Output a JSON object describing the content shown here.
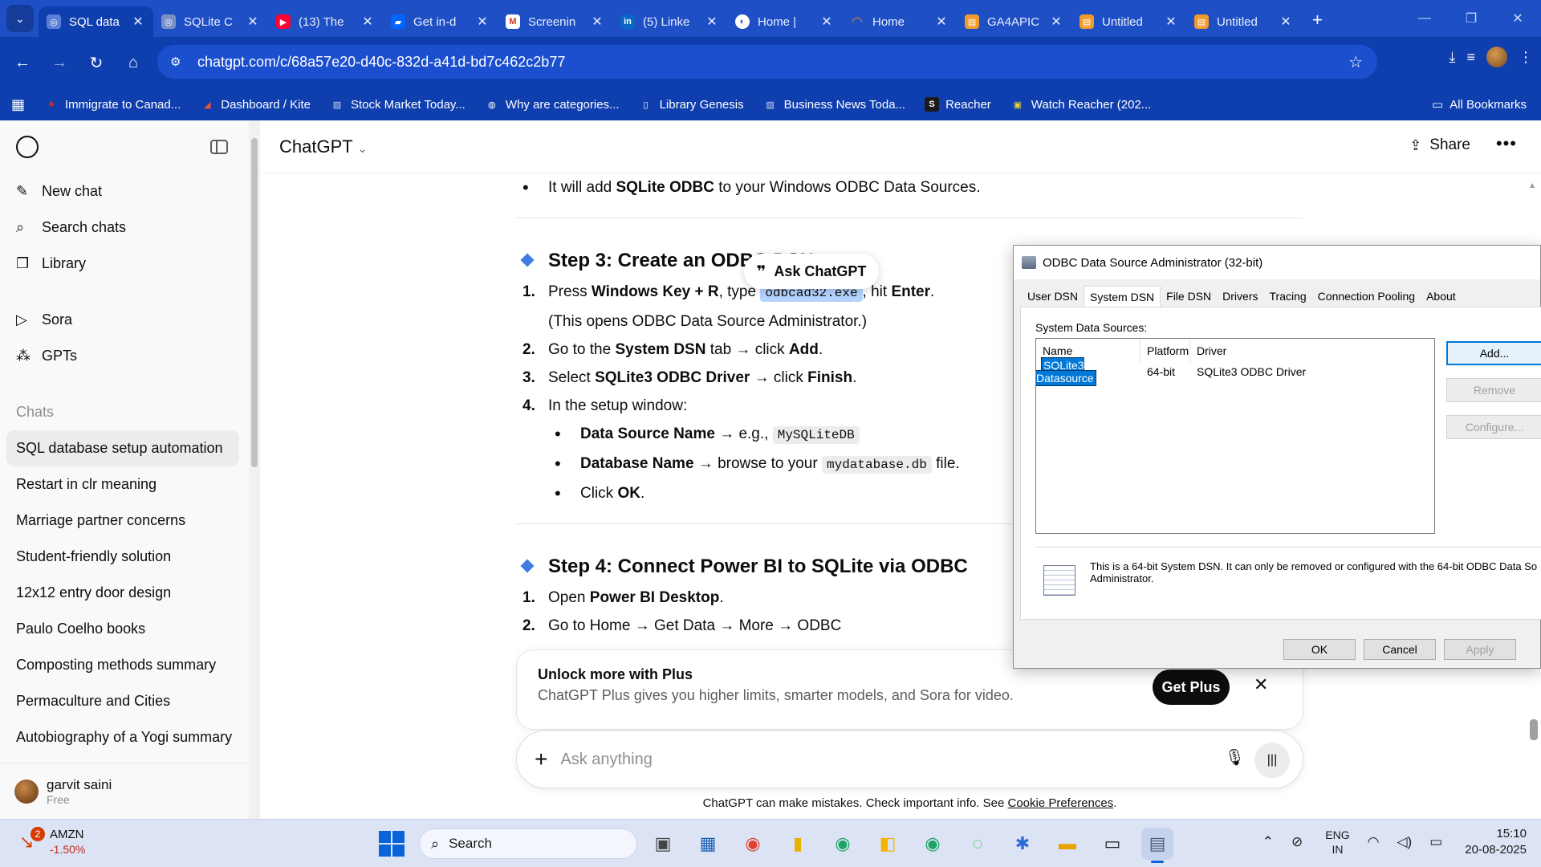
{
  "browser": {
    "tabs": [
      {
        "title": "SQL data",
        "icon": "chatgpt-icon",
        "active": true
      },
      {
        "title": "SQLite C",
        "icon": "chatgpt-icon"
      },
      {
        "title": "(13) The",
        "icon": "youtube-icon"
      },
      {
        "title": "Get in-d",
        "icon": "power-automate-icon"
      },
      {
        "title": "Screenin",
        "icon": "gmail-icon"
      },
      {
        "title": "(5) Linke",
        "icon": "linkedin-icon"
      },
      {
        "title": "Home | ",
        "icon": "bookmark-app-icon"
      },
      {
        "title": "Home",
        "icon": "loading-spinner-icon"
      },
      {
        "title": "GA4APIC",
        "icon": "orange-doc-icon"
      },
      {
        "title": "Untitled",
        "icon": "orange-doc-icon"
      },
      {
        "title": "Untitled",
        "icon": "orange-doc-icon"
      }
    ],
    "url": "chatgpt.com/c/68a57e20-d40c-832d-a41d-bd7c462c2b77",
    "bookmarks": [
      {
        "label": "Immigrate to Canad...",
        "icon": "maple-leaf-icon",
        "color": "#d52b1e"
      },
      {
        "label": "Dashboard / Kite",
        "icon": "kite-icon",
        "color": "#f0512f"
      },
      {
        "label": "Stock Market Today...",
        "icon": "news-icon",
        "color": "#cfd8ee"
      },
      {
        "label": "Why are categories...",
        "icon": "globe-icon",
        "color": "#ffffff"
      },
      {
        "label": "Library Genesis",
        "icon": "book-icon",
        "color": "#ffffff"
      },
      {
        "label": "Business News Toda...",
        "icon": "news-icon",
        "color": "#cfd8ee"
      },
      {
        "label": "Reacher",
        "icon": "s-icon",
        "color": "#1a1a1a"
      },
      {
        "label": "Watch Reacher (202...",
        "icon": "tv-icon",
        "color": "#e8d13a"
      }
    ],
    "all_bookmarks": "All Bookmarks"
  },
  "sidebar": {
    "nav": [
      {
        "label": "New chat",
        "icon": "new-chat-icon"
      },
      {
        "label": "Search chats",
        "icon": "search-icon"
      },
      {
        "label": "Library",
        "icon": "library-icon"
      }
    ],
    "nav2": [
      {
        "label": "Sora",
        "icon": "sora-icon"
      },
      {
        "label": "GPTs",
        "icon": "gpts-icon"
      }
    ],
    "chats_label": "Chats",
    "chats": [
      "SQL database setup automation",
      "Restart in clr meaning",
      "Marriage partner concerns",
      "Student-friendly solution",
      "12x12 entry door design",
      "Paulo Coelho books",
      "Composting methods summary",
      "Permaculture and Cities",
      "Autobiography of a Yogi summary"
    ],
    "user": {
      "name": "garvit saini",
      "plan": "Free"
    }
  },
  "header": {
    "model": "ChatGPT",
    "share": "Share"
  },
  "content": {
    "bullet_top": {
      "pre": "It will add ",
      "bold": "SQLite ODBC",
      "post": " to your Windows ODBC Data Sources."
    },
    "step3_title": "Step 3: Create an ODBC DSN",
    "ask_chatgpt": "Ask ChatGPT",
    "s3_1": {
      "a": "Press ",
      "b": "Windows Key + R",
      "c": ", type ",
      "code": "odbcad32.exe",
      "d": ", hit ",
      "e": "Enter",
      "f": "."
    },
    "s3_1b": "(This opens ODBC Data Source Administrator.)",
    "s3_2": {
      "a": "Go to the ",
      "b": "System DSN",
      "c": " tab → click ",
      "d": "Add",
      "e": "."
    },
    "s3_3": {
      "a": "Select ",
      "b": "SQLite3 ODBC Driver",
      "c": " → click ",
      "d": "Finish",
      "e": "."
    },
    "s3_4": "In the setup window:",
    "s3_4a": {
      "b": "Data Source Name",
      "c": " → e.g., ",
      "code": "MySQLiteDB"
    },
    "s3_4b": {
      "b": "Database Name",
      "c": " → browse to your ",
      "code": "mydatabase.db",
      "d": " file."
    },
    "s3_4c": {
      "a": "Click ",
      "b": "OK",
      "c": "."
    },
    "step4_title": "Step 4: Connect Power BI to SQLite via ODBC",
    "s4_1": {
      "a": "Open ",
      "b": "Power BI Desktop",
      "c": "."
    },
    "s4_2": "Go to Home → Get Data → More → ODBC"
  },
  "plus_banner": {
    "title": "Unlock more with Plus",
    "text": "ChatGPT Plus gives you higher limits, smarter models, and Sora for video.",
    "button": "Get Plus"
  },
  "composer": {
    "placeholder": "Ask anything"
  },
  "disclaimer": {
    "text": "ChatGPT can make mistakes. Check important info. See ",
    "link": "Cookie Preferences",
    "end": "."
  },
  "odbc": {
    "title": "ODBC Data Source Administrator (32-bit)",
    "tabs": [
      "User DSN",
      "System DSN",
      "File DSN",
      "Drivers",
      "Tracing",
      "Connection Pooling",
      "About"
    ],
    "active_tab": "System DSN",
    "list_label": "System Data Sources:",
    "columns": [
      "Name",
      "Platform",
      "Driver"
    ],
    "rows": [
      {
        "name": "SQLite3 Datasource",
        "platform": "64-bit",
        "driver": "SQLite3 ODBC Driver"
      }
    ],
    "buttons": {
      "add": "Add...",
      "remove": "Remove",
      "configure": "Configure..."
    },
    "info": "This is a 64-bit System DSN. It can only be removed or configured with the 64-bit ODBC Data So Administrator.",
    "footer": {
      "ok": "OK",
      "cancel": "Cancel",
      "apply": "Apply"
    }
  },
  "taskbar": {
    "stock": {
      "symbol": "AMZN",
      "change": "-1.50%",
      "badge": "2"
    },
    "search": "Search",
    "language": {
      "l1": "ENG",
      "l2": "IN"
    },
    "time": "15:10",
    "date": "20-08-2025"
  }
}
